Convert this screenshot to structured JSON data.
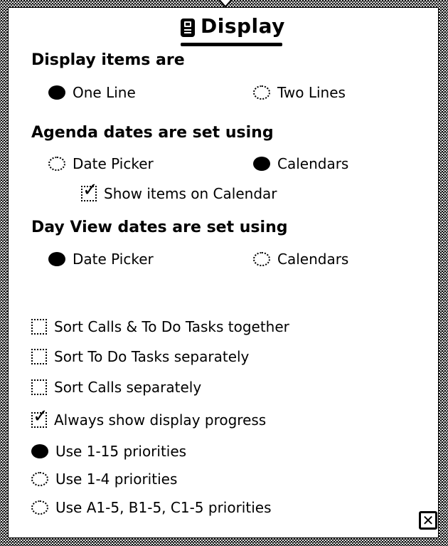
{
  "title": {
    "text": "Display",
    "icon": "note-icon"
  },
  "display_items": {
    "heading": "Display items are",
    "options": [
      {
        "label": "One Line",
        "selected": true
      },
      {
        "label": "Two Lines",
        "selected": false
      }
    ]
  },
  "agenda_dates": {
    "heading": "Agenda dates are set using",
    "options": [
      {
        "label": "Date Picker",
        "selected": false
      },
      {
        "label": "Calendars",
        "selected": true
      }
    ],
    "show_on_calendar": {
      "label": "Show items on Calendar",
      "checked": true
    }
  },
  "dayview_dates": {
    "heading": "Day View dates are set using",
    "options": [
      {
        "label": "Date Picker",
        "selected": true
      },
      {
        "label": "Calendars",
        "selected": false
      }
    ]
  },
  "sort_options": [
    {
      "label": "Sort Calls & To Do Tasks together",
      "checked": false
    },
    {
      "label": "Sort To Do Tasks separately",
      "checked": false
    },
    {
      "label": "Sort Calls separately",
      "checked": false
    },
    {
      "label": "Always show display progress",
      "checked": true
    }
  ],
  "priorities": [
    {
      "label": "Use 1-15 priorities",
      "selected": true
    },
    {
      "label": "Use 1-4 priorities",
      "selected": false
    },
    {
      "label": "Use A1-5, B1-5, C1-5 priorities",
      "selected": false
    }
  ],
  "close": {
    "label": "✕"
  }
}
